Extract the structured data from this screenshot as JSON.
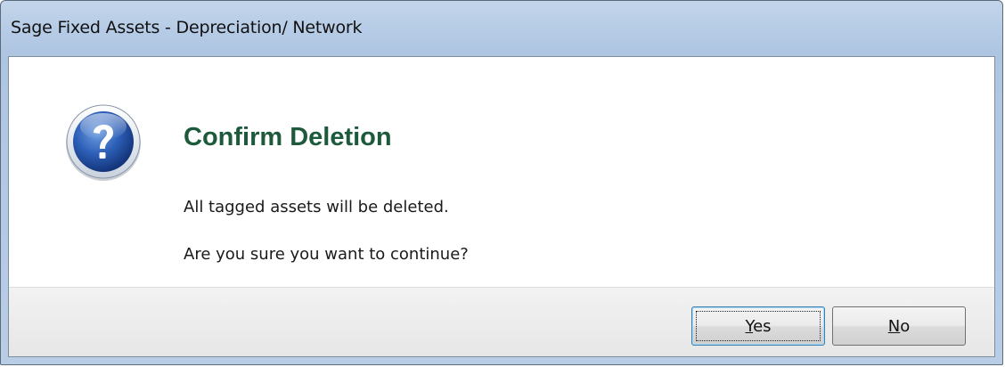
{
  "window": {
    "title": "Sage Fixed Assets - Depreciation/ Network"
  },
  "dialog": {
    "icon": "question-icon",
    "heading": "Confirm Deletion",
    "message_line1": "All tagged assets will be deleted.",
    "message_line2": "Are you sure you want to continue?",
    "heading_color": "#1d5a3b"
  },
  "buttons": {
    "yes_mnemonic": "Y",
    "yes_rest": "es",
    "no_mnemonic": "N",
    "no_rest": "o",
    "default": "Yes"
  }
}
